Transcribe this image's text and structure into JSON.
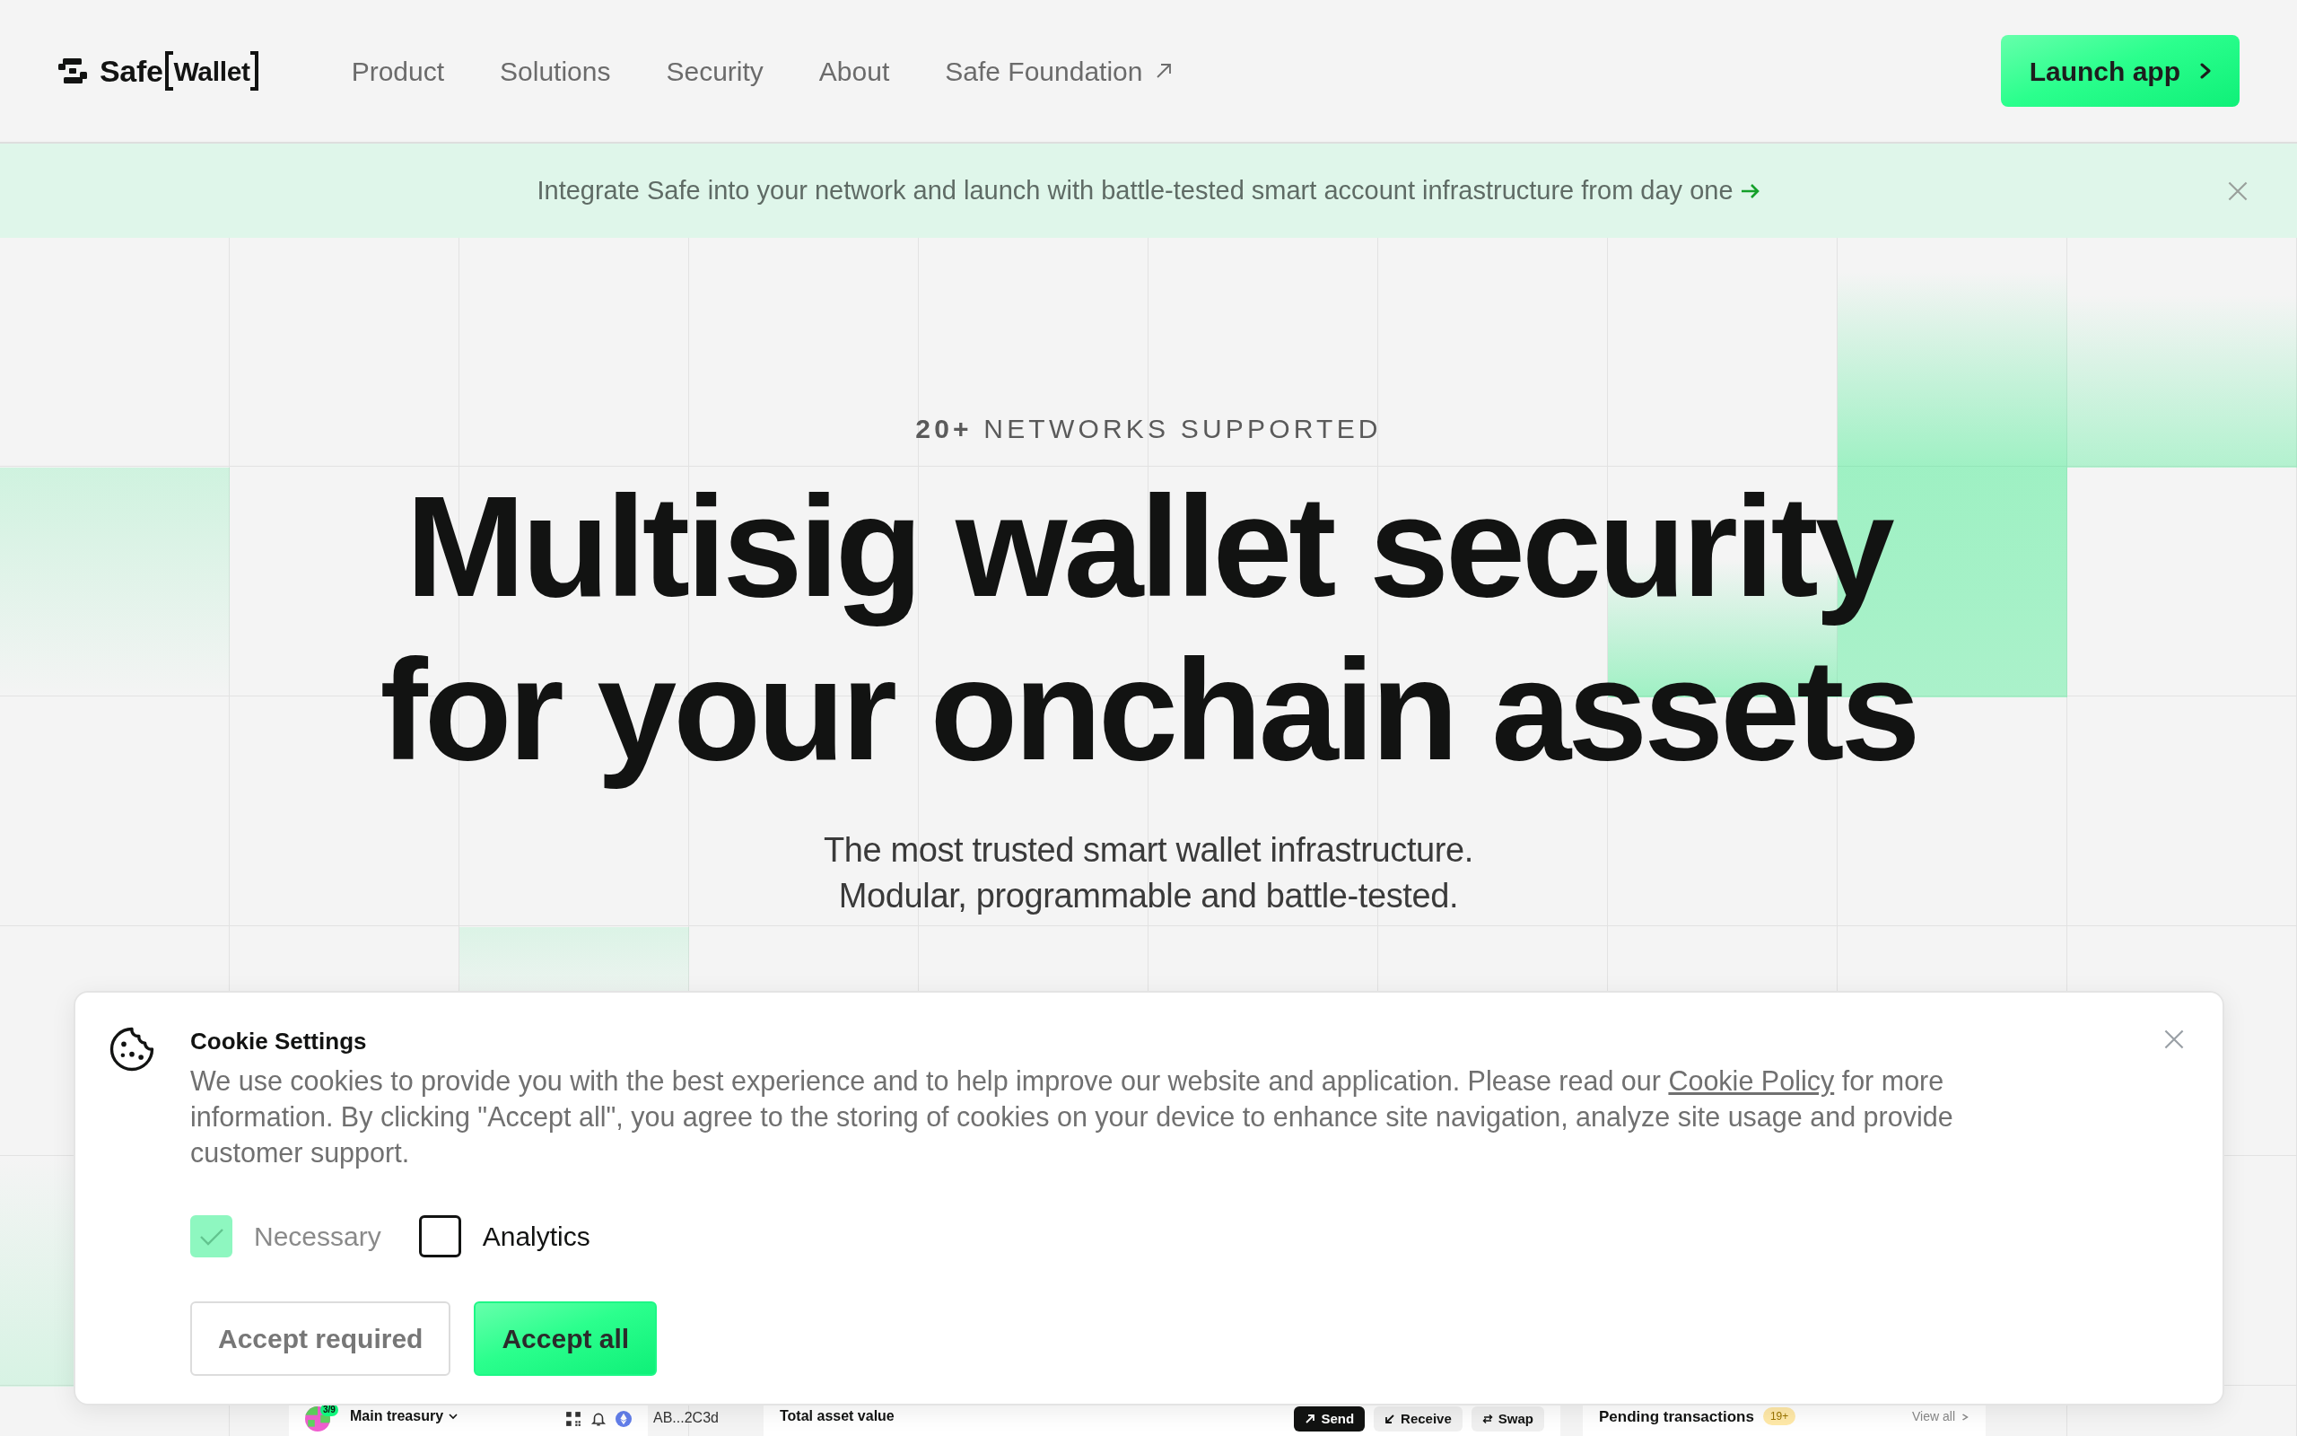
{
  "navbar": {
    "logo": {
      "name": "Safe",
      "product": "Wallet"
    },
    "links": [
      {
        "label": "Product",
        "external": false
      },
      {
        "label": "Solutions",
        "external": false
      },
      {
        "label": "Security",
        "external": false
      },
      {
        "label": "About",
        "external": false
      },
      {
        "label": "Safe Foundation",
        "external": true
      }
    ],
    "cta": "Launch app"
  },
  "announcement": {
    "text": "Integrate Safe into your network and launch with battle-tested smart account infrastructure from day one"
  },
  "hero": {
    "eyebrow": "**20+** NETWORKS SUPPORTED",
    "title_lines": [
      "Multisig wallet security",
      "for your onchain assets"
    ],
    "subtitle_lines": [
      "The most trusted smart wallet infrastructure.",
      "Modular, programmable and battle-tested."
    ]
  },
  "app_preview": {
    "safe": {
      "threshold": "3/9",
      "name": "Main treasury"
    },
    "address": "AB...2C3d",
    "balance_label": "Total asset value",
    "actions": [
      {
        "label": "Send",
        "kind": "send"
      },
      {
        "label": "Receive",
        "kind": "receive"
      },
      {
        "label": "Swap",
        "kind": "swap"
      }
    ],
    "pending": {
      "title": "Pending transactions",
      "count": "19+",
      "link": "View all"
    }
  },
  "cookie_dialog": {
    "title": "Cookie Settings",
    "text_before": "We use cookies to provide you with the best experience and to help improve our website and application. Please read our ",
    "policy_link": "Cookie Policy",
    "text_after": " for more information. By clicking \"Accept all\", you agree to the storing of cookies on your device to enhance site navigation, analyze site usage and provide customer support.",
    "options": [
      {
        "label": "Necessary",
        "checked": true,
        "disabled": true
      },
      {
        "label": "Analytics",
        "checked": false,
        "disabled": false
      }
    ],
    "buttons": [
      {
        "label": "Accept required",
        "kind": "secondary"
      },
      {
        "label": "Accept all",
        "kind": "primary"
      }
    ]
  }
}
